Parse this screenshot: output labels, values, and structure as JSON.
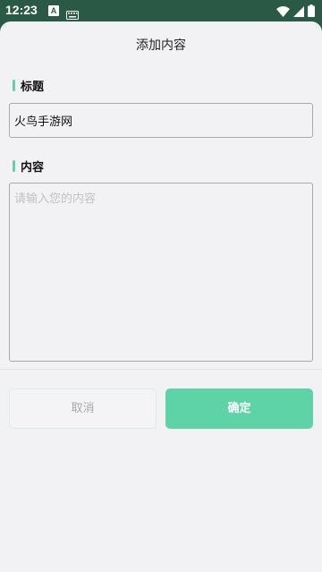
{
  "statusbar": {
    "time": "12:23",
    "notification_letter": "A",
    "icons": [
      "keyboard-icon",
      "wifi-icon",
      "signal-icon",
      "battery-icon"
    ]
  },
  "dialog": {
    "title": "添加内容",
    "title_section": {
      "label": "标题",
      "value": "火鸟手游网"
    },
    "content_section": {
      "label": "内容",
      "placeholder": "请输入您的内容",
      "value": ""
    },
    "buttons": {
      "cancel": "取消",
      "confirm": "确定"
    }
  },
  "colors": {
    "accent": "#5fd3a8",
    "statusbar_bg": "#2a5a45",
    "sheet_bg": "#f2f2f4"
  }
}
